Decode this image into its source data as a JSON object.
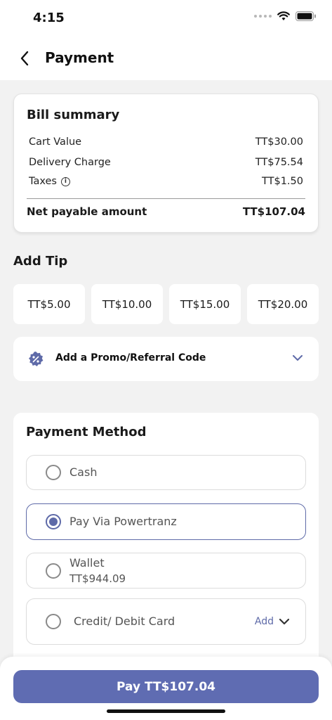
{
  "status": {
    "time": "4:15"
  },
  "header": {
    "title": "Payment"
  },
  "bill": {
    "title": "Bill summary",
    "rows": [
      {
        "label": "Cart Value",
        "amount": "TT$30.00"
      },
      {
        "label": "Delivery Charge",
        "amount": "TT$75.54"
      },
      {
        "label": "Taxes",
        "amount": "TT$1.50"
      }
    ],
    "net_label": "Net payable amount",
    "net_amount": "TT$107.04"
  },
  "tip": {
    "title": "Add Tip",
    "options": [
      "TT$5.00",
      "TT$10.00",
      "TT$15.00",
      "TT$20.00"
    ]
  },
  "promo": {
    "label": "Add a Promo/Referral Code"
  },
  "payment": {
    "title": "Payment Method",
    "options": [
      {
        "label": "Cash",
        "selected": false
      },
      {
        "label": "Pay Via Powertranz",
        "selected": true
      },
      {
        "label": "Wallet",
        "sub": "TT$944.09",
        "selected": false
      },
      {
        "label": "Credit/ Debit Card",
        "action": "Add",
        "selected": false
      }
    ]
  },
  "pay_button": {
    "label": "Pay TT$107.04"
  },
  "colors": {
    "accent": "#5f6cb2",
    "background": "#f2f2f2"
  }
}
